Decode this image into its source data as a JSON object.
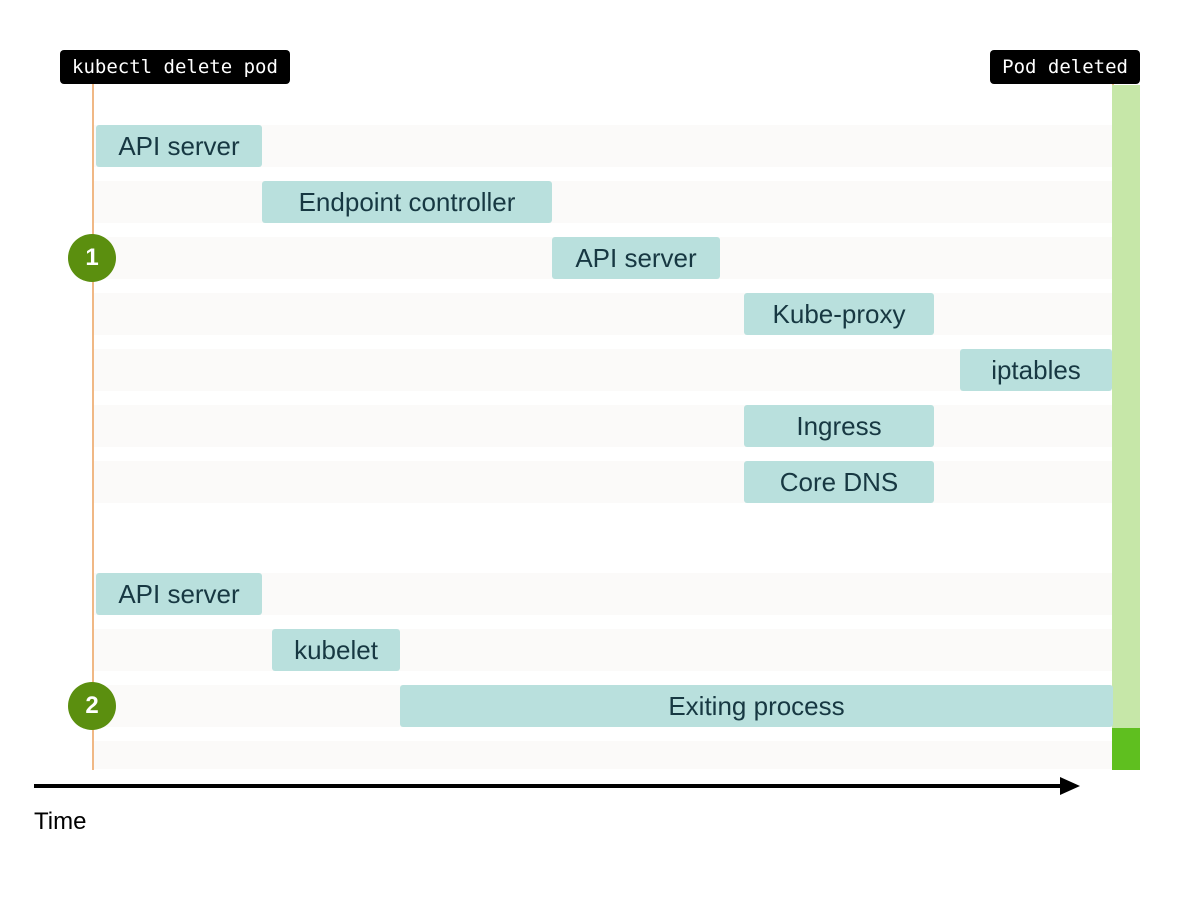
{
  "markers": {
    "start": "kubectl delete pod",
    "end": "Pod deleted"
  },
  "badges": {
    "one": "1",
    "two": "2"
  },
  "axis_label": "Time",
  "colors": {
    "task_fill": "#b9e0dd",
    "task_text": "#173842",
    "badge": "#5b8f0f",
    "marker_bg": "#000000",
    "strip": "#c6e7a8",
    "strip_accent": "#5fbf1f",
    "row_bg": "#fbfaf9",
    "guide_line": "#f0b885"
  },
  "chart_data": {
    "type": "bar",
    "title": "",
    "xlabel": "Time",
    "ylabel": "",
    "xlim": [
      0,
      100
    ],
    "groups": [
      {
        "id": 1,
        "rows": [
          {
            "label": "API server",
            "start": 3,
            "end": 18
          },
          {
            "label": "Endpoint controller",
            "start": 18,
            "end": 49
          },
          {
            "label": "API server",
            "start": 49,
            "end": 65
          },
          {
            "label": "Kube-proxy",
            "start": 67,
            "end": 86
          },
          {
            "label": "iptables",
            "start": 86,
            "end": 100
          },
          {
            "label": "Ingress",
            "start": 67,
            "end": 86
          },
          {
            "label": "Core DNS",
            "start": 67,
            "end": 86
          }
        ]
      },
      {
        "id": 2,
        "rows": [
          {
            "label": "API server",
            "start": 3,
            "end": 18
          },
          {
            "label": "kubelet",
            "start": 19,
            "end": 32
          },
          {
            "label": "Exiting process",
            "start": 32,
            "end": 100
          }
        ]
      }
    ],
    "events": [
      {
        "label": "kubectl delete pod",
        "x": 0
      },
      {
        "label": "Pod deleted",
        "x": 100
      }
    ]
  },
  "tasks": {
    "g1r1": "API server",
    "g1r2": "Endpoint controller",
    "g1r3": "API server",
    "g1r4": "Kube-proxy",
    "g1r5": "iptables",
    "g1r6": "Ingress",
    "g1r7": "Core DNS",
    "g2r1": "API server",
    "g2r2": "kubelet",
    "g2r3": "Exiting process"
  }
}
